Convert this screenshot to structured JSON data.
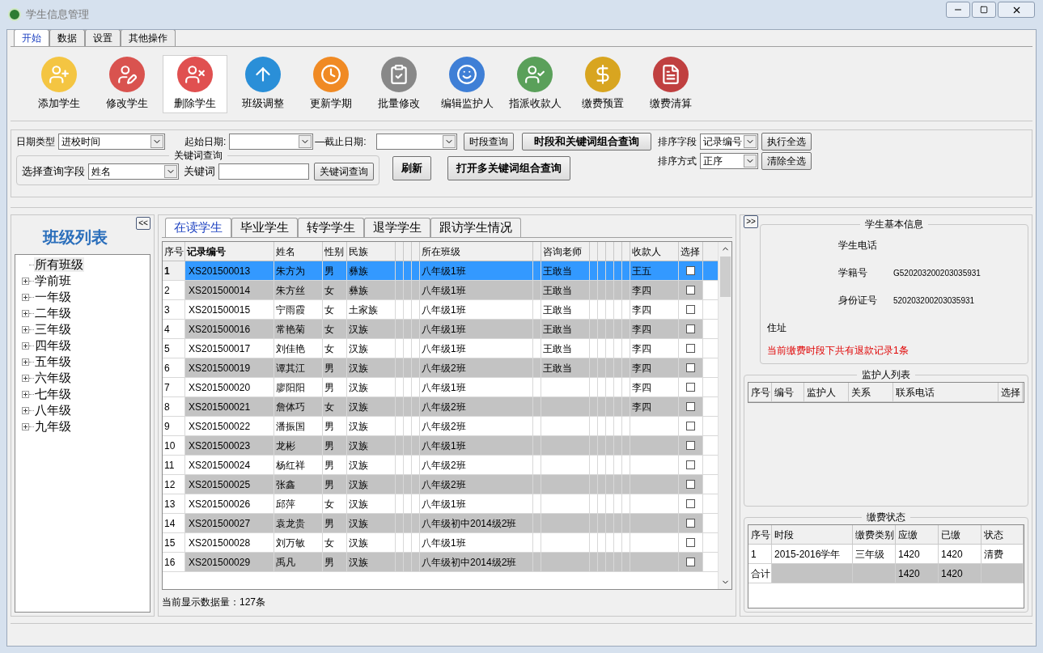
{
  "window": {
    "title": "学生信息管理"
  },
  "ribbon_tabs": [
    {
      "label": "开始",
      "selected": true
    },
    {
      "label": "数据",
      "selected": false
    },
    {
      "label": "设置",
      "selected": false
    },
    {
      "label": "其他操作",
      "selected": false
    }
  ],
  "toolbar": [
    {
      "label": "添加学生",
      "selected": false
    },
    {
      "label": "修改学生",
      "selected": false
    },
    {
      "label": "删除学生",
      "selected": true
    },
    {
      "label": "班级调整",
      "selected": false
    },
    {
      "label": "更新学期",
      "selected": false
    },
    {
      "label": "批量修改",
      "selected": false
    },
    {
      "label": "编辑监护人",
      "selected": false
    },
    {
      "label": "指派收款人",
      "selected": false
    },
    {
      "label": "缴费预置",
      "selected": false
    },
    {
      "label": "缴费清算",
      "selected": false
    }
  ],
  "filters": {
    "date_type_label": "日期类型",
    "date_type_value": "进校时间",
    "start_label": "起始日期:",
    "end_label": "—截止日期:",
    "period_button": "时段查询",
    "combined_button": "时段和关键词组合查询",
    "sort_field_label": "排序字段",
    "sort_field_value": "记录编号",
    "sort_order_label": "排序方式",
    "sort_order_value": "正序",
    "select_all_button": "执行全选",
    "clear_all_button": "清除全选",
    "keyword_group": {
      "title": "关键词查询",
      "field_label": "选择查询字段",
      "field_value": "姓名",
      "keyword_label": "关键词",
      "search_button": "关键词查询"
    },
    "refresh_button": "刷新",
    "multi_button": "打开多关键词组合查询"
  },
  "class_list": {
    "title": "班级列表",
    "collapse_button": "<<",
    "tree": [
      {
        "label": "所有班级",
        "kind": "leaf",
        "selected": true
      },
      {
        "label": "学前班",
        "kind": "group",
        "selected": false
      },
      {
        "label": "一年级",
        "kind": "group",
        "selected": false
      },
      {
        "label": "二年级",
        "kind": "group",
        "selected": false
      },
      {
        "label": "三年级",
        "kind": "group",
        "selected": false
      },
      {
        "label": "四年级",
        "kind": "group",
        "selected": false
      },
      {
        "label": "五年级",
        "kind": "group",
        "selected": false
      },
      {
        "label": "六年级",
        "kind": "group",
        "selected": false
      },
      {
        "label": "七年级",
        "kind": "group",
        "selected": false
      },
      {
        "label": "八年级",
        "kind": "group",
        "selected": false
      },
      {
        "label": "九年级",
        "kind": "group",
        "selected": false
      }
    ]
  },
  "student_tabs": [
    {
      "label": "在读学生",
      "selected": true
    },
    {
      "label": "毕业学生",
      "selected": false
    },
    {
      "label": "转学学生",
      "selected": false
    },
    {
      "label": "退学学生",
      "selected": false
    },
    {
      "label": "跟访学生情况",
      "selected": false
    }
  ],
  "table": {
    "columns": [
      "序号",
      "记录编号",
      "姓名",
      "性别",
      "民族",
      "所在班级",
      "咨询老师",
      "收款人",
      "选择"
    ],
    "rows": [
      {
        "no": "1",
        "id": "XS201500013",
        "name": "朱方为",
        "sex": "男",
        "ethnicity": "彝族",
        "class": "八年级1班",
        "teacher": "王敢当",
        "payee": "王五",
        "checked": false,
        "selected": true
      },
      {
        "no": "2",
        "id": "XS201500014",
        "name": "朱方丝",
        "sex": "女",
        "ethnicity": "彝族",
        "class": "八年级1班",
        "teacher": "王敢当",
        "payee": "李四",
        "checked": false,
        "selected": false
      },
      {
        "no": "3",
        "id": "XS201500015",
        "name": "宁雨霞",
        "sex": "女",
        "ethnicity": "土家族",
        "class": "八年级1班",
        "teacher": "王敢当",
        "payee": "李四",
        "checked": false,
        "selected": false
      },
      {
        "no": "4",
        "id": "XS201500016",
        "name": "常艳菊",
        "sex": "女",
        "ethnicity": "汉族",
        "class": "八年级1班",
        "teacher": "王敢当",
        "payee": "李四",
        "checked": false,
        "selected": false
      },
      {
        "no": "5",
        "id": "XS201500017",
        "name": "刘佳艳",
        "sex": "女",
        "ethnicity": "汉族",
        "class": "八年级1班",
        "teacher": "王敢当",
        "payee": "李四",
        "checked": false,
        "selected": false
      },
      {
        "no": "6",
        "id": "XS201500019",
        "name": "谭其江",
        "sex": "男",
        "ethnicity": "汉族",
        "class": "八年级2班",
        "teacher": "王敢当",
        "payee": "李四",
        "checked": false,
        "selected": false
      },
      {
        "no": "7",
        "id": "XS201500020",
        "name": "廖阳阳",
        "sex": "男",
        "ethnicity": "汉族",
        "class": "八年级1班",
        "payee": "李四",
        "checked": false,
        "selected": false
      },
      {
        "no": "8",
        "id": "XS201500021",
        "name": "詹体巧",
        "sex": "女",
        "ethnicity": "汉族",
        "class": "八年级2班",
        "payee": "李四",
        "checked": false,
        "selected": false
      },
      {
        "no": "9",
        "id": "XS201500022",
        "name": "潘振国",
        "sex": "男",
        "ethnicity": "汉族",
        "class": "八年级2班",
        "checked": false,
        "selected": false
      },
      {
        "no": "10",
        "id": "XS201500023",
        "name": "龙彬",
        "sex": "男",
        "ethnicity": "汉族",
        "class": "八年级1班",
        "checked": false,
        "selected": false
      },
      {
        "no": "11",
        "id": "XS201500024",
        "name": "杨红祥",
        "sex": "男",
        "ethnicity": "汉族",
        "class": "八年级2班",
        "checked": false,
        "selected": false
      },
      {
        "no": "12",
        "id": "XS201500025",
        "name": "张鑫",
        "sex": "男",
        "ethnicity": "汉族",
        "class": "八年级2班",
        "checked": false,
        "selected": false
      },
      {
        "no": "13",
        "id": "XS201500026",
        "name": "邱萍",
        "sex": "女",
        "ethnicity": "汉族",
        "class": "八年级1班",
        "checked": false,
        "selected": false
      },
      {
        "no": "14",
        "id": "XS201500027",
        "name": "袁龙贵",
        "sex": "男",
        "ethnicity": "汉族",
        "class": "八年级初中2014级2班",
        "checked": false,
        "selected": false
      },
      {
        "no": "15",
        "id": "XS201500028",
        "name": "刘万敏",
        "sex": "女",
        "ethnicity": "汉族",
        "class": "八年级1班",
        "checked": false,
        "selected": false
      },
      {
        "no": "16",
        "id": "XS201500029",
        "name": "禹凡",
        "sex": "男",
        "ethnicity": "汉族",
        "class": "八年级初中2014级2班",
        "checked": false,
        "selected": false
      }
    ]
  },
  "record_count": "当前显示数据量：127条",
  "expand_button": ">>",
  "student_info": {
    "title": "学生基本信息",
    "phone_label": "学生电话",
    "roll_label": "学籍号",
    "roll_value": "G520203200203035931",
    "id_label": "身份证号",
    "id_value": "520203200203035931",
    "address_label": "住址",
    "refund_notice": "当前缴费时段下共有退款记录1条"
  },
  "guardians": {
    "title": "监护人列表",
    "columns": [
      "序号",
      "编号",
      "监护人",
      "关系",
      "联系电话",
      "选择"
    ]
  },
  "fees": {
    "title": "缴费状态",
    "columns": [
      "序号",
      "时段",
      "缴费类别",
      "应缴",
      "已缴",
      "状态"
    ],
    "rows": [
      {
        "kind": "item",
        "no": "1",
        "period": "2015-2016学年",
        "category": "三年级",
        "due": "1420",
        "paid": "1420",
        "status": "清费"
      },
      {
        "kind": "total",
        "no": "合计",
        "due": "1420",
        "paid": "1420"
      }
    ]
  }
}
